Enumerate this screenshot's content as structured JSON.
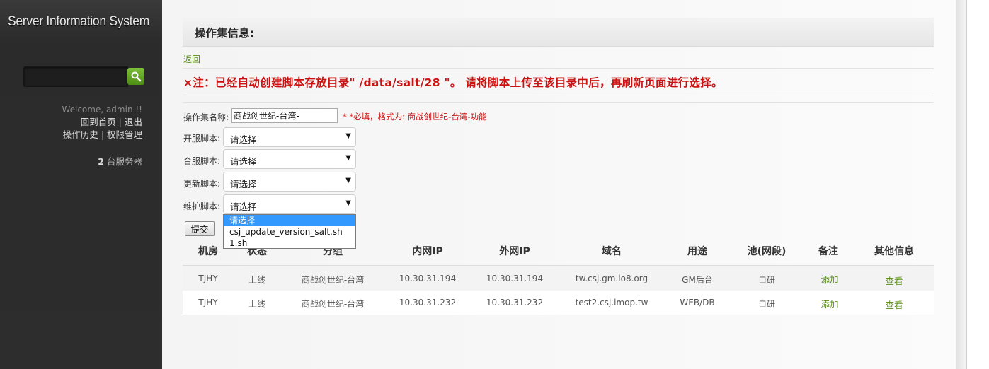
{
  "sidebar": {
    "app_title": "Server Information System",
    "search_placeholder": "",
    "welcome": "Welcome, admin !!",
    "links": [
      "回到首页",
      "退出",
      "操作历史",
      "权限管理"
    ],
    "server_count": "2",
    "server_label": "台服务器"
  },
  "page": {
    "header": "操作集信息:",
    "back": "返回",
    "note": "×注：已经自动创建脚本存放目录\" /data/salt/28 \"。 请将脚本上传至该目录中后，再刷新页面进行选择。"
  },
  "form": {
    "name_label": "操作集名称:",
    "name_value": "商战创世纪-台湾-",
    "name_hint": "* *必填，格式为: 商战创世纪-台湾-功能",
    "fields": [
      {
        "label": "开服脚本:",
        "value": "请选择"
      },
      {
        "label": "合服脚本:",
        "value": "请选择"
      },
      {
        "label": "更新脚本:",
        "value": "请选择"
      },
      {
        "label": "维护脚本:",
        "value": "请选择"
      }
    ],
    "dropdown_options": [
      "请选择",
      "csj_update_version_salt.sh",
      "1.sh"
    ],
    "submit": "提交"
  },
  "table": {
    "headers": [
      "机房",
      "状态",
      "分组",
      "内网IP",
      "外网IP",
      "域名",
      "用途",
      "池(网段)",
      "备注",
      "其他信息"
    ],
    "rows": [
      [
        "TJHY",
        "上线",
        "商战创世纪-台湾",
        "10.30.31.194",
        "10.30.31.194",
        "tw.csj.gm.io8.org",
        "GM后台",
        "自研",
        "添加",
        "查看"
      ],
      [
        "TJHY",
        "上线",
        "商战创世纪-台湾",
        "10.30.31.232",
        "10.30.31.232",
        "test2.csj.imop.tw",
        "WEB/DB",
        "自研",
        "添加",
        "查看"
      ]
    ]
  },
  "colors": {
    "accent_green": "#5a8c1b",
    "alert_red": "#cc1111",
    "select_highlight": "#3399ff"
  }
}
